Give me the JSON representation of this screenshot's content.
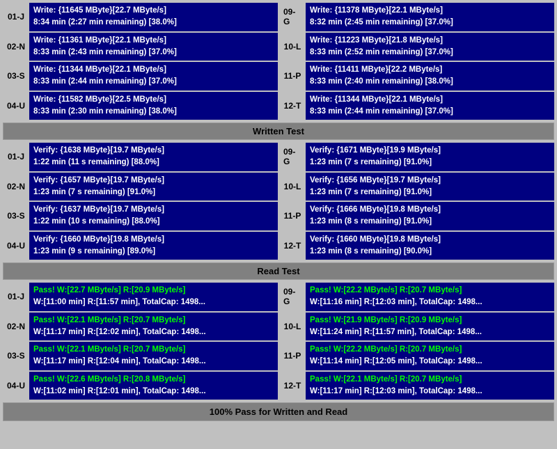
{
  "sections": {
    "write": {
      "rows": [
        {
          "left": {
            "id": "01-J",
            "line1": "Write: {11645 MByte}[22.7 MByte/s]",
            "line2": "8:34 min (2:27 min remaining)  [38.0%]"
          },
          "right": {
            "id": "09-G",
            "line1": "Write: {11378 MByte}[22.1 MByte/s]",
            "line2": "8:32 min (2:45 min remaining)  [37.0%]"
          }
        },
        {
          "left": {
            "id": "02-N",
            "line1": "Write: {11361 MByte}[22.1 MByte/s]",
            "line2": "8:33 min (2:43 min remaining)  [37.0%]"
          },
          "right": {
            "id": "10-L",
            "line1": "Write: {11223 MByte}[21.8 MByte/s]",
            "line2": "8:33 min (2:52 min remaining)  [37.0%]"
          }
        },
        {
          "left": {
            "id": "03-S",
            "line1": "Write: {11344 MByte}[22.1 MByte/s]",
            "line2": "8:33 min (2:44 min remaining)  [37.0%]"
          },
          "right": {
            "id": "11-P",
            "line1": "Write: {11411 MByte}[22.2 MByte/s]",
            "line2": "8:33 min (2:40 min remaining)  [38.0%]"
          }
        },
        {
          "left": {
            "id": "04-U",
            "line1": "Write: {11582 MByte}[22.5 MByte/s]",
            "line2": "8:33 min (2:30 min remaining)  [38.0%]"
          },
          "right": {
            "id": "12-T",
            "line1": "Write: {11344 MByte}[22.1 MByte/s]",
            "line2": "8:33 min (2:44 min remaining)  [37.0%]"
          }
        }
      ],
      "header": "Written Test"
    },
    "verify": {
      "rows": [
        {
          "left": {
            "id": "01-J",
            "line1": "Verify: {1638 MByte}[19.7 MByte/s]",
            "line2": "1:22 min (11 s remaining)   [88.0%]"
          },
          "right": {
            "id": "09-G",
            "line1": "Verify: {1671 MByte}[19.9 MByte/s]",
            "line2": "1:23 min (7 s remaining)   [91.0%]"
          }
        },
        {
          "left": {
            "id": "02-N",
            "line1": "Verify: {1657 MByte}[19.7 MByte/s]",
            "line2": "1:23 min (7 s remaining)   [91.0%]"
          },
          "right": {
            "id": "10-L",
            "line1": "Verify: {1656 MByte}[19.7 MByte/s]",
            "line2": "1:23 min (7 s remaining)   [91.0%]"
          }
        },
        {
          "left": {
            "id": "03-S",
            "line1": "Verify: {1637 MByte}[19.7 MByte/s]",
            "line2": "1:22 min (10 s remaining)   [88.0%]"
          },
          "right": {
            "id": "11-P",
            "line1": "Verify: {1666 MByte}[19.8 MByte/s]",
            "line2": "1:23 min (8 s remaining)   [91.0%]"
          }
        },
        {
          "left": {
            "id": "04-U",
            "line1": "Verify: {1660 MByte}[19.8 MByte/s]",
            "line2": "1:23 min (9 s remaining)   [89.0%]"
          },
          "right": {
            "id": "12-T",
            "line1": "Verify: {1660 MByte}[19.8 MByte/s]",
            "line2": "1:23 min (8 s remaining)   [90.0%]"
          }
        }
      ],
      "header": "Read Test"
    },
    "pass": {
      "rows": [
        {
          "left": {
            "id": "01-J",
            "line1": "Pass! W:[22.7 MByte/s] R:[20.9 MByte/s]",
            "line2": "W:[11:00 min] R:[11:57 min], TotalCap: 1498..."
          },
          "right": {
            "id": "09-G",
            "line1": "Pass! W:[22.2 MByte/s] R:[20.7 MByte/s]",
            "line2": "W:[11:16 min] R:[12:03 min], TotalCap: 1498..."
          }
        },
        {
          "left": {
            "id": "02-N",
            "line1": "Pass! W:[22.1 MByte/s] R:[20.7 MByte/s]",
            "line2": "W:[11:17 min] R:[12:02 min], TotalCap: 1498..."
          },
          "right": {
            "id": "10-L",
            "line1": "Pass! W:[21.9 MByte/s] R:[20.9 MByte/s]",
            "line2": "W:[11:24 min] R:[11:57 min], TotalCap: 1498..."
          }
        },
        {
          "left": {
            "id": "03-S",
            "line1": "Pass! W:[22.1 MByte/s] R:[20.7 MByte/s]",
            "line2": "W:[11:17 min] R:[12:04 min], TotalCap: 1498..."
          },
          "right": {
            "id": "11-P",
            "line1": "Pass! W:[22.2 MByte/s] R:[20.7 MByte/s]",
            "line2": "W:[11:14 min] R:[12:05 min], TotalCap: 1498..."
          }
        },
        {
          "left": {
            "id": "04-U",
            "line1": "Pass! W:[22.6 MByte/s] R:[20.8 MByte/s]",
            "line2": "W:[11:02 min] R:[12:01 min], TotalCap: 1498..."
          },
          "right": {
            "id": "12-T",
            "line1": "Pass! W:[22.1 MByte/s] R:[20.7 MByte/s]",
            "line2": "W:[11:17 min] R:[12:03 min], TotalCap: 1498..."
          }
        }
      ]
    },
    "footer": "100% Pass for Written and Read"
  }
}
